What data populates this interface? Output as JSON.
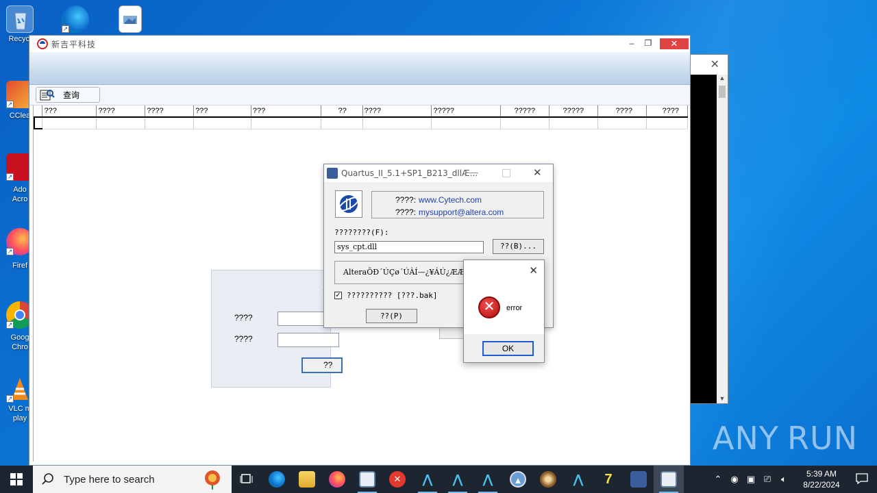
{
  "desktop": {
    "icons": [
      {
        "label": "Recycl"
      },
      {
        "label": "CClea"
      },
      {
        "label": "Ado\nAcro"
      },
      {
        "label": "Firef"
      },
      {
        "label": "Goog\nChro"
      },
      {
        "label": "VLC m\nplay"
      }
    ]
  },
  "main_window": {
    "title": "新吉平科技",
    "toolbar": {
      "query_label": "查询"
    },
    "grid": {
      "columns": [
        "???",
        "????",
        "????",
        "???",
        "???",
        "??",
        "????",
        "?????",
        "?????",
        "?????",
        "????",
        "????"
      ]
    },
    "login": {
      "title_mark": "?",
      "field1_label": "????",
      "field2_label": "????",
      "button_label": "??"
    }
  },
  "quartus_dialog": {
    "title": "Quartus_II_5.1+SP1_B213_dllÆ...",
    "info": {
      "row1_key": "????:",
      "row1_value": "www.Cytech.com",
      "row2_key": "????:",
      "row2_value": "mysupport@altera.com"
    },
    "file_label": "????????(F):",
    "file_value": "sys_cpt.dll",
    "browse_label": "??(B)...",
    "status_text": "AlteraÕÐ´ÚÇø´ÚÀÍ—¿¥ÁÚ¿ÆÆ¾µÃ¿",
    "backup_checked": true,
    "backup_label": "?????????? [???.bak]",
    "patch_label": "??(P)"
  },
  "error_dialog": {
    "message": "error",
    "ok_label": "OK"
  },
  "watermark": {
    "left": "ANY",
    "right": "RUN"
  },
  "taskbar": {
    "search_placeholder": "Type here to search",
    "time": "5:39 AM",
    "date": "8/22/2024"
  }
}
